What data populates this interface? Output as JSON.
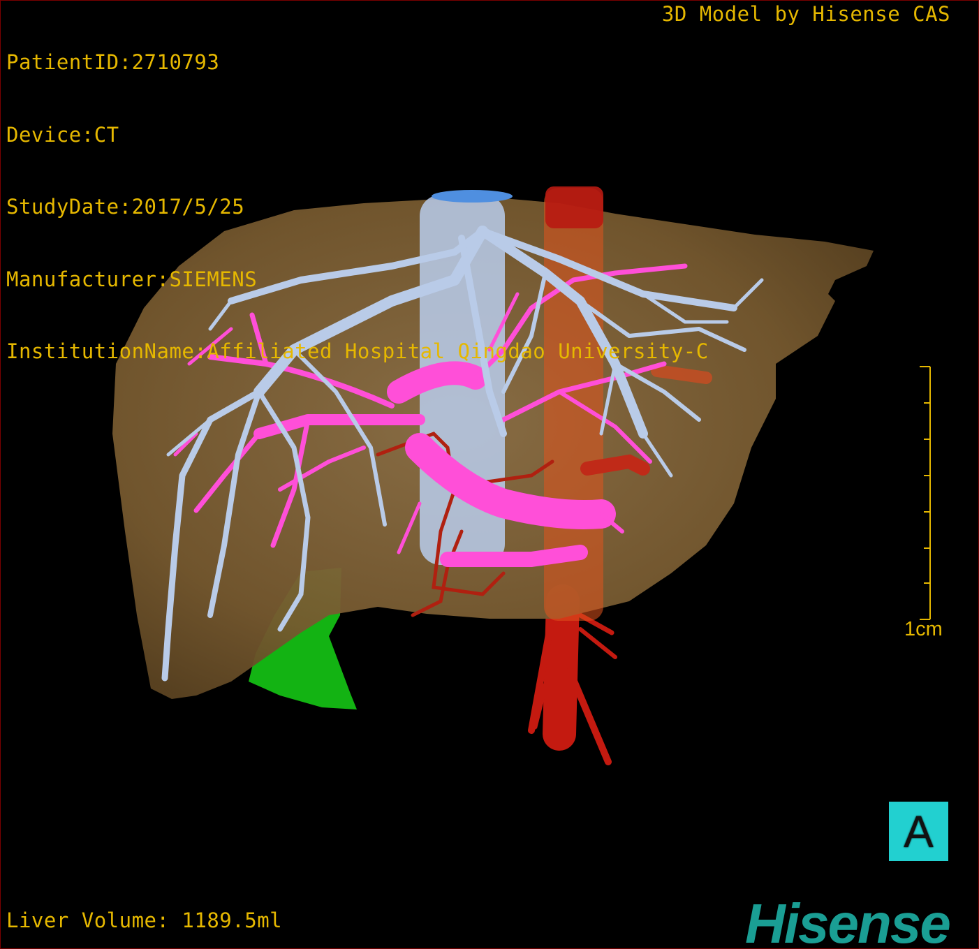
{
  "overlay": {
    "patient_id": "PatientID:2710793",
    "device": "Device:CT",
    "study_date": "StudyDate:2017/5/25",
    "manufacturer": "Manufacturer:SIEMENS",
    "institution": "InstitutionName:Affiliated Hospital Qingdao University-C",
    "credit": "3D Model by Hisense CAS",
    "liver_volume": "Liver Volume: 1189.5ml"
  },
  "scale": {
    "label": "1cm"
  },
  "orientation": {
    "label": "A"
  },
  "brand": {
    "logo_text": "Hisense"
  },
  "colors": {
    "osd_text": "#e6b800",
    "liver": "#8a6a40",
    "hepatic_vein": "#b8c8e6",
    "portal_vein": "#ff4fd8",
    "artery": "#cc1a10",
    "gallbladder": "#12b012",
    "orientation_cube": "#22d0d0",
    "brand": "#1a9e94"
  }
}
